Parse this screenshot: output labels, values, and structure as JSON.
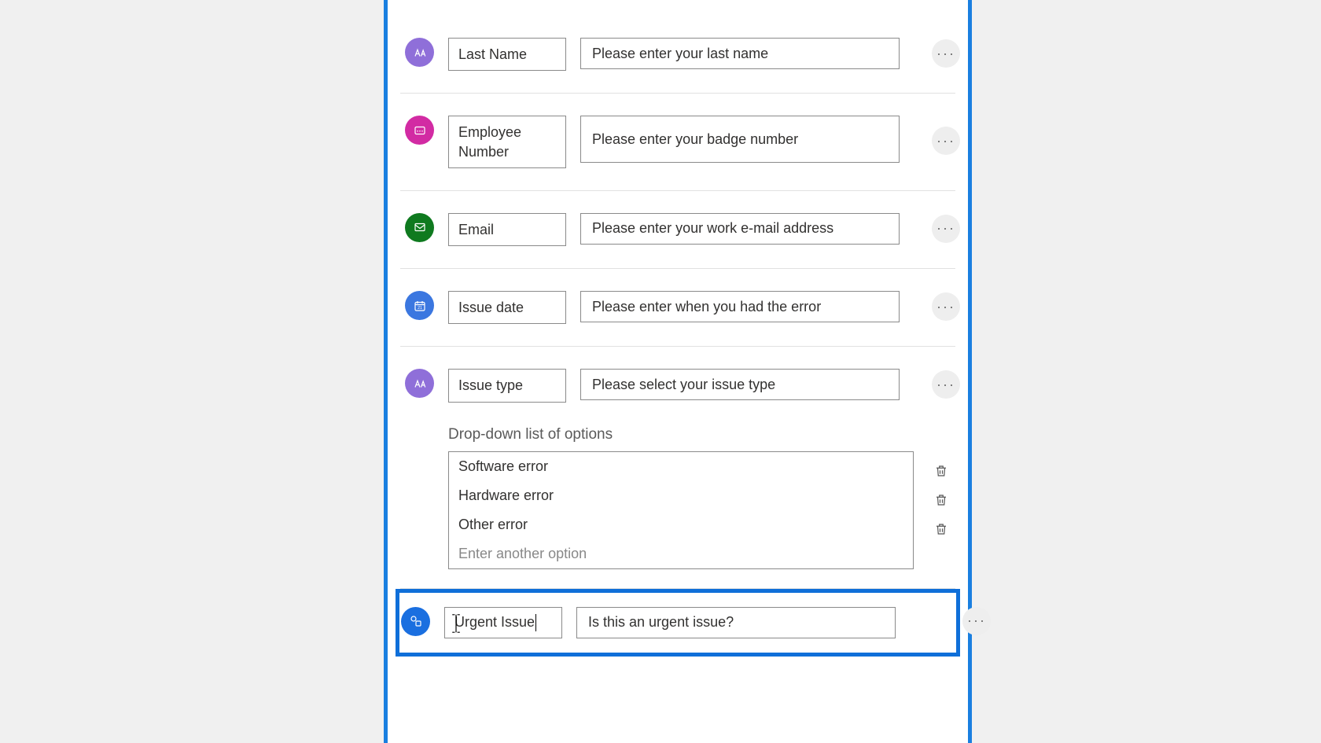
{
  "questions": [
    {
      "id": "last_name",
      "label": "Last Name",
      "prompt": "Please enter your last name"
    },
    {
      "id": "employee_number",
      "label": "Employee Number",
      "prompt": "Please enter your badge number"
    },
    {
      "id": "email",
      "label": "Email",
      "prompt": "Please enter your work e-mail address"
    },
    {
      "id": "issue_date",
      "label": "Issue date",
      "prompt": "Please enter when you had the error"
    },
    {
      "id": "issue_type",
      "label": "Issue type",
      "prompt": "Please select your issue type"
    },
    {
      "id": "urgent_issue",
      "label": "Urgent Issue",
      "prompt": "Is this an urgent issue?"
    }
  ],
  "dropdown": {
    "title": "Drop-down list of options",
    "options": [
      "Software error",
      "Hardware error",
      "Other error"
    ],
    "placeholder": "Enter another option"
  },
  "icons": {
    "more": "···"
  }
}
